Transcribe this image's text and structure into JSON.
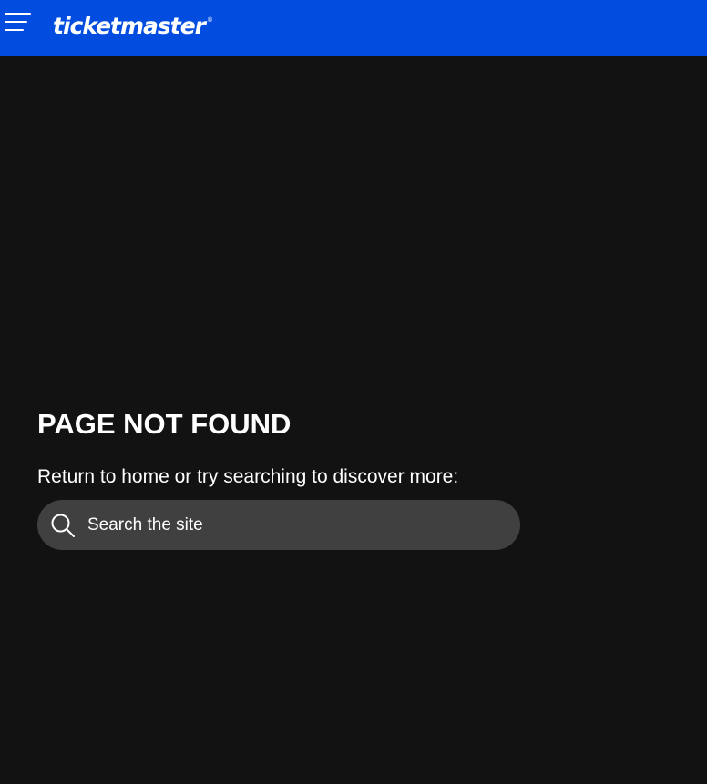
{
  "header": {
    "menu_icon": "hamburger-menu-icon",
    "logo_text": "ticketmaster",
    "logo_mark": "®",
    "background_color": "#024ddf"
  },
  "error": {
    "title": "PAGE NOT FOUND",
    "message": "Return to home or try searching to discover more:"
  },
  "search": {
    "placeholder": "Search the site",
    "value": "",
    "icon": "search-icon"
  },
  "colors": {
    "page_background": "#121212",
    "search_background": "#404040",
    "text": "#ffffff"
  }
}
